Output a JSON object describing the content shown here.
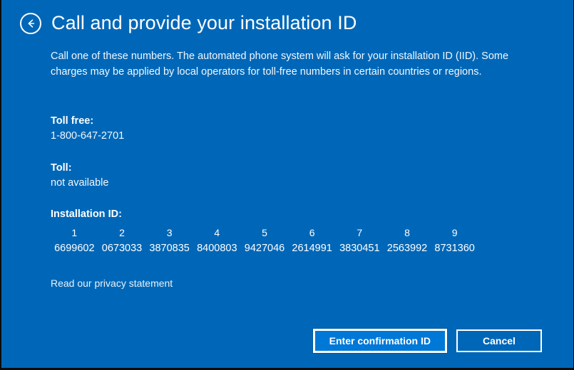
{
  "window": {
    "background_color": "#0067b8",
    "title": "Call and provide your installation ID"
  },
  "header": {
    "back_icon": "back-arrow-circle-icon",
    "title": "Call and provide your installation ID"
  },
  "intro": {
    "text": "Call one of these numbers. The automated phone system will ask for your installation ID (IID). Some charges may be applied by local operators for toll-free numbers in certain countries or regions."
  },
  "phone_numbers": [
    {
      "label": "Toll free:",
      "value": "1-800-647-2701"
    },
    {
      "label": "Toll:",
      "value": "not available"
    }
  ],
  "installation_id": {
    "label": "Installation ID:",
    "columns": [
      {
        "index": "1",
        "digits": "6699602"
      },
      {
        "index": "2",
        "digits": "0673033"
      },
      {
        "index": "3",
        "digits": "3870835"
      },
      {
        "index": "4",
        "digits": "8400803"
      },
      {
        "index": "5",
        "digits": "9427046"
      },
      {
        "index": "6",
        "digits": "2614991"
      },
      {
        "index": "7",
        "digits": "3830451"
      },
      {
        "index": "8",
        "digits": "2563992"
      },
      {
        "index": "9",
        "digits": "8731360"
      }
    ]
  },
  "privacy": {
    "link_text": "Read our privacy statement"
  },
  "footer": {
    "primary_label": "Enter confirmation ID",
    "cancel_label": "Cancel",
    "primary_color": "#0078d7"
  }
}
